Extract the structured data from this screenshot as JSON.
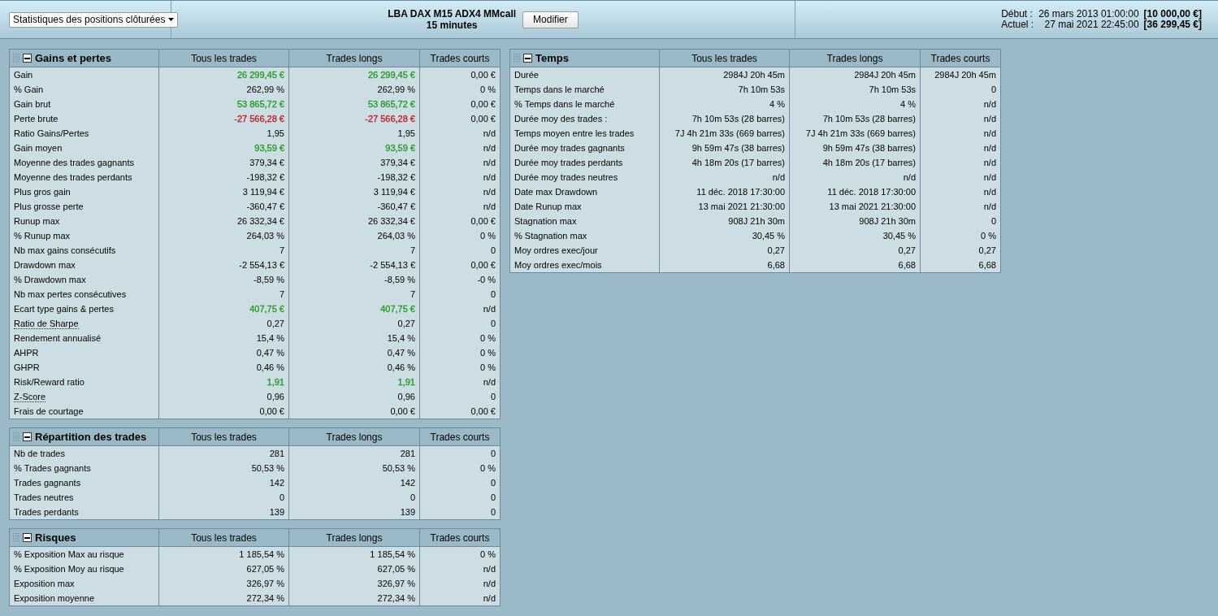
{
  "toolbar": {
    "view_selector": "Statistiques des positions clôturées",
    "strategy_name": "LBA DAX M15 ADX4 MMcall",
    "timeframe": "15 minutes",
    "edit_button": "Modifier",
    "period": [
      {
        "label": "Début :",
        "date": "26 mars 2013 01:00:00",
        "amount": "[10 000,00 €]"
      },
      {
        "label": "Actuel :",
        "date": "27 mai 2021 22:45:00",
        "amount": "[36 299,45 €]"
      }
    ]
  },
  "columns": [
    {
      "panels": [
        {
          "title": "Gains et pertes",
          "expanded": true,
          "headers": [
            "Tous les trades",
            "Trades longs",
            "Trades courts"
          ],
          "rows": [
            {
              "label": "Gain",
              "values": [
                {
                  "text": "26 299,45 €",
                  "color": "#1f9a1f"
                },
                {
                  "text": "26 299,45 €",
                  "color": "#1f9a1f"
                },
                "0,00 €"
              ]
            },
            {
              "label": "% Gain",
              "values": [
                "262,99 %",
                "262,99 %",
                "0 %"
              ]
            },
            {
              "label": "Gain brut",
              "values": [
                {
                  "text": "53 865,72 €",
                  "color": "#1f9a1f"
                },
                {
                  "text": "53 865,72 €",
                  "color": "#1f9a1f"
                },
                "0,00 €"
              ]
            },
            {
              "label": "Perte brute",
              "values": [
                {
                  "text": "-27 566,28 €",
                  "color": "#c01818"
                },
                {
                  "text": "-27 566,28 €",
                  "color": "#c01818"
                },
                "0,00 €"
              ]
            },
            {
              "label": "Ratio Gains/Pertes",
              "values": [
                "1,95",
                "1,95",
                "n/d"
              ]
            },
            {
              "label": "Gain moyen",
              "values": [
                {
                  "text": "93,59 €",
                  "color": "#1f9a1f"
                },
                {
                  "text": "93,59 €",
                  "color": "#1f9a1f"
                },
                "n/d"
              ]
            },
            {
              "label": "Moyenne des trades gagnants",
              "values": [
                "379,34 €",
                "379,34 €",
                "n/d"
              ]
            },
            {
              "label": "Moyenne des trades perdants",
              "values": [
                "-198,32 €",
                "-198,32 €",
                "n/d"
              ]
            },
            {
              "label": "Plus gros gain",
              "values": [
                "3 119,94 €",
                "3 119,94 €",
                "n/d"
              ]
            },
            {
              "label": "Plus grosse perte",
              "values": [
                "-360,47 €",
                "-360,47 €",
                "n/d"
              ]
            },
            {
              "label": "Runup max",
              "values": [
                "26 332,34 €",
                "26 332,34 €",
                "0,00 €"
              ]
            },
            {
              "label": "% Runup max",
              "values": [
                "264,03 %",
                "264,03 %",
                "0 %"
              ]
            },
            {
              "label": "Nb max gains consécutifs",
              "values": [
                "7",
                "7",
                "0"
              ]
            },
            {
              "label": "Drawdown max",
              "values": [
                "-2 554,13 €",
                "-2 554,13 €",
                "0,00 €"
              ]
            },
            {
              "label": "% Drawdown max",
              "values": [
                "-8,59 %",
                "-8,59 %",
                "-0 %"
              ]
            },
            {
              "label": "Nb max pertes consécutives",
              "values": [
                "7",
                "7",
                "0"
              ]
            },
            {
              "label": "Ecart type gains & pertes",
              "values": [
                {
                  "text": "407,75 €",
                  "color": "#1f9a1f"
                },
                {
                  "text": "407,75 €",
                  "color": "#1f9a1f"
                },
                "n/d"
              ]
            },
            {
              "label": "Ratio de Sharpe",
              "hint": true,
              "values": [
                "0,27",
                "0,27",
                "0"
              ]
            },
            {
              "label": "Rendement annualisé",
              "values": [
                "15,4 %",
                "15,4 %",
                "0 %"
              ]
            },
            {
              "label": "AHPR",
              "values": [
                "0,47 %",
                "0,47 %",
                "0 %"
              ]
            },
            {
              "label": "GHPR",
              "values": [
                "0,46 %",
                "0,46 %",
                "0 %"
              ]
            },
            {
              "label": "Risk/Reward ratio",
              "values": [
                {
                  "text": "1,91",
                  "color": "#1f9a1f"
                },
                {
                  "text": "1,91",
                  "color": "#1f9a1f"
                },
                "n/d"
              ]
            },
            {
              "label": "Z-Score",
              "hint": true,
              "values": [
                "0,96",
                "0,96",
                "0"
              ]
            },
            {
              "label": "Frais de courtage",
              "values": [
                "0,00 €",
                "0,00 €",
                "0,00 €"
              ]
            }
          ]
        },
        {
          "title": "Répartition des trades",
          "expanded": true,
          "headers": [
            "Tous les trades",
            "Trades longs",
            "Trades courts"
          ],
          "rows": [
            {
              "label": "Nb de trades",
              "values": [
                "281",
                "281",
                "0"
              ]
            },
            {
              "label": "% Trades gagnants",
              "values": [
                "50,53 %",
                "50,53 %",
                "0 %"
              ]
            },
            {
              "label": "Trades gagnants",
              "values": [
                "142",
                "142",
                "0"
              ]
            },
            {
              "label": "Trades neutres",
              "values": [
                "0",
                "0",
                "0"
              ]
            },
            {
              "label": "Trades perdants",
              "values": [
                "139",
                "139",
                "0"
              ]
            }
          ]
        },
        {
          "title": "Risques",
          "expanded": true,
          "headers": [
            "Tous les trades",
            "Trades longs",
            "Trades courts"
          ],
          "rows": [
            {
              "label": "% Exposition Max au risque",
              "values": [
                "1 185,54 %",
                "1 185,54 %",
                "0 %"
              ]
            },
            {
              "label": "% Exposition Moy au risque",
              "values": [
                "627,05 %",
                "627,05 %",
                "n/d"
              ]
            },
            {
              "label": "Exposition max",
              "values": [
                "326,97 %",
                "326,97 %",
                "n/d"
              ]
            },
            {
              "label": "Exposition moyenne",
              "values": [
                "272,34 %",
                "272,34 %",
                "n/d"
              ]
            }
          ]
        }
      ]
    },
    {
      "panels": [
        {
          "title": "Temps",
          "expanded": true,
          "headers": [
            "Tous les trades",
            "Trades longs",
            "Trades courts"
          ],
          "rows": [
            {
              "label": "Durée",
              "values": [
                "2984J 20h 45m",
                "2984J 20h 45m",
                "2984J 20h 45m"
              ]
            },
            {
              "label": "Temps dans le marché",
              "values": [
                "7h 10m 53s",
                "7h 10m 53s",
                "0"
              ]
            },
            {
              "label": "% Temps dans le marché",
              "values": [
                "4 %",
                "4 %",
                "n/d"
              ]
            },
            {
              "label": "Durée moy des trades :",
              "values": [
                "7h 10m 53s (28 barres)",
                "7h 10m 53s (28 barres)",
                "n/d"
              ]
            },
            {
              "label": "Temps moyen entre les trades",
              "values": [
                "7J 4h 21m 33s (669 barres)",
                "7J 4h 21m 33s (669 barres)",
                "n/d"
              ]
            },
            {
              "label": "Durée moy trades gagnants",
              "values": [
                "9h 59m 47s (38 barres)",
                "9h 59m 47s (38 barres)",
                "n/d"
              ]
            },
            {
              "label": "Durée moy trades perdants",
              "values": [
                "4h 18m 20s (17 barres)",
                "4h 18m 20s (17 barres)",
                "n/d"
              ]
            },
            {
              "label": "Durée moy trades neutres",
              "values": [
                "n/d",
                "n/d",
                "n/d"
              ]
            },
            {
              "label": "Date max Drawdown",
              "values": [
                "11 déc. 2018 17:30:00",
                "11 déc. 2018 17:30:00",
                "n/d"
              ]
            },
            {
              "label": "Date Runup max",
              "values": [
                "13 mai 2021 21:30:00",
                "13 mai 2021 21:30:00",
                "n/d"
              ]
            },
            {
              "label": "Stagnation max",
              "values": [
                "908J 21h 30m",
                "908J 21h 30m",
                "0"
              ]
            },
            {
              "label": "% Stagnation max",
              "values": [
                "30,45 %",
                "30,45 %",
                "0 %"
              ]
            },
            {
              "label": "Moy ordres exec/jour",
              "values": [
                "0,27",
                "0,27",
                "0,27"
              ]
            },
            {
              "label": "Moy ordres exec/mois",
              "values": [
                "6,68",
                "6,68",
                "6,68"
              ]
            }
          ]
        }
      ]
    }
  ]
}
